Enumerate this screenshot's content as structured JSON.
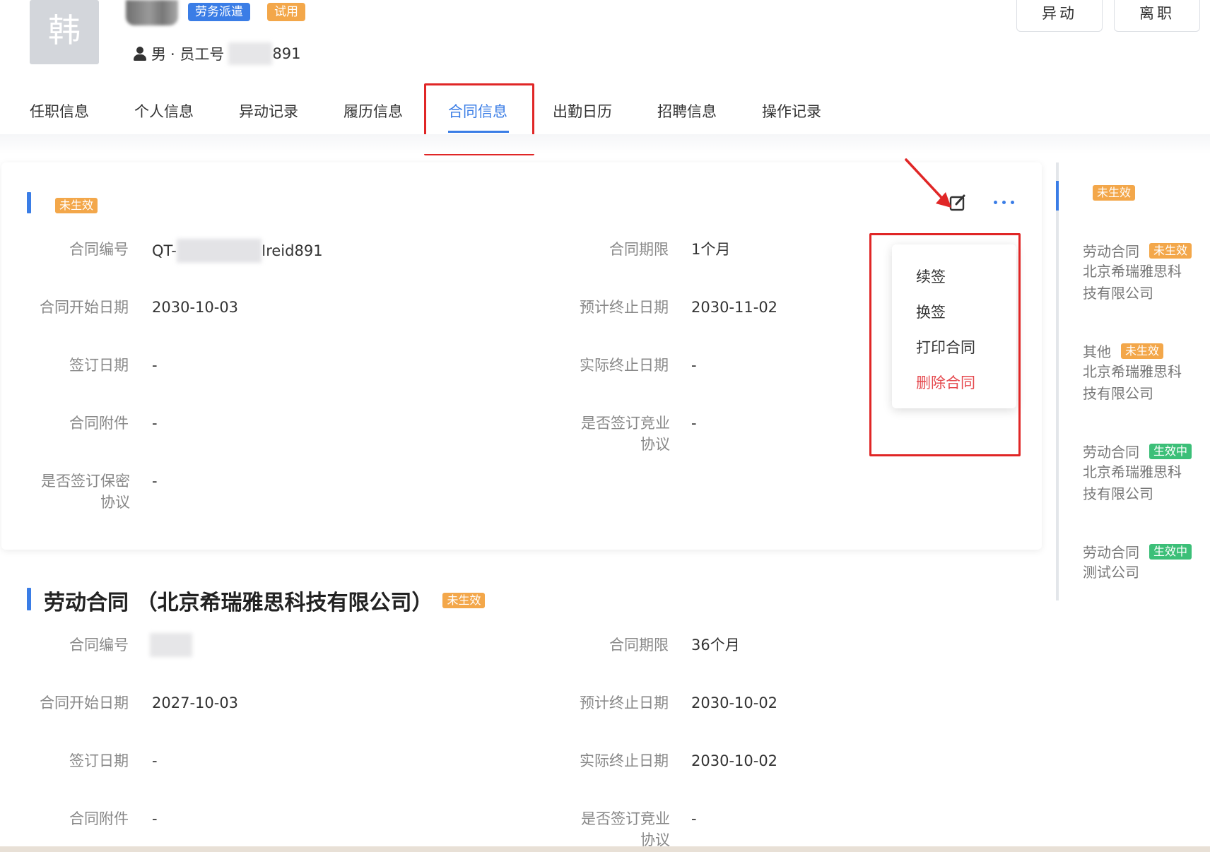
{
  "employee": {
    "avatar_char": "韩",
    "tags": [
      "劳务派遣",
      "试用"
    ],
    "gender": "男",
    "employee_no_label": "· 员工号",
    "employee_no_suffix": "891"
  },
  "header_buttons": {
    "transfer": "异动",
    "resign": "离职"
  },
  "tabs": [
    "任职信息",
    "个人信息",
    "异动记录",
    "履历信息",
    "合同信息",
    "出勤日历",
    "招聘信息",
    "操作记录"
  ],
  "active_tab": "合同信息",
  "contract1": {
    "status": "未生效",
    "fields": {
      "contract_no_label": "合同编号",
      "contract_no_prefix": "QT-",
      "contract_no_suffix": "Ireid891",
      "term_label": "合同期限",
      "term": "1个月",
      "start_label": "合同开始日期",
      "start": "2030-10-03",
      "expected_end_label": "预计终止日期",
      "expected_end": "2030-11-02",
      "sign_date_label": "签订日期",
      "sign_date": "-",
      "actual_end_label": "实际终止日期",
      "actual_end": "-",
      "attachment_label": "合同附件",
      "attachment": "-",
      "noncompete_label_1": "是否签订竞业",
      "noncompete_label_2": "协议",
      "noncompete": "-",
      "confidential_label_1": "是否签订保密",
      "confidential_label_2": "协议",
      "confidential": "-"
    }
  },
  "more_menu": {
    "items": [
      "续签",
      "换签",
      "打印合同"
    ],
    "danger_item": "删除合同"
  },
  "contract2": {
    "title": "劳动合同 （北京希瑞雅思科技有限公司）",
    "status": "未生效",
    "fields": {
      "contract_no_label": "合同编号",
      "term_label": "合同期限",
      "term": "36个月",
      "start_label": "合同开始日期",
      "start": "2027-10-03",
      "expected_end_label": "预计终止日期",
      "expected_end": "2030-10-02",
      "sign_date_label": "签订日期",
      "sign_date": "-",
      "actual_end_label": "实际终止日期",
      "actual_end": "2030-10-02",
      "attachment_label": "合同附件",
      "attachment": "-",
      "noncompete_label_1": "是否签订竞业",
      "noncompete_label_2": "协议",
      "noncompete": "-"
    }
  },
  "timeline": {
    "top_status": "未生效",
    "items": [
      {
        "type": "劳动合同",
        "status": "未生效",
        "company_1": "北京希瑞雅思科",
        "company_2": "技有限公司"
      },
      {
        "type": "其他",
        "status": "未生效",
        "company_1": "北京希瑞雅思科",
        "company_2": "技有限公司"
      },
      {
        "type": "劳动合同",
        "status": "生效中",
        "company_1": "北京希瑞雅思科",
        "company_2": "技有限公司"
      },
      {
        "type": "劳动合同",
        "status": "生效中",
        "company_1": "测试公司",
        "company_2": ""
      }
    ]
  },
  "colors": {
    "accent": "#3a7de6",
    "pending": "#f3a74a",
    "active": "#3cbf78",
    "danger": "#e5484d",
    "highlight": "#e02626"
  }
}
